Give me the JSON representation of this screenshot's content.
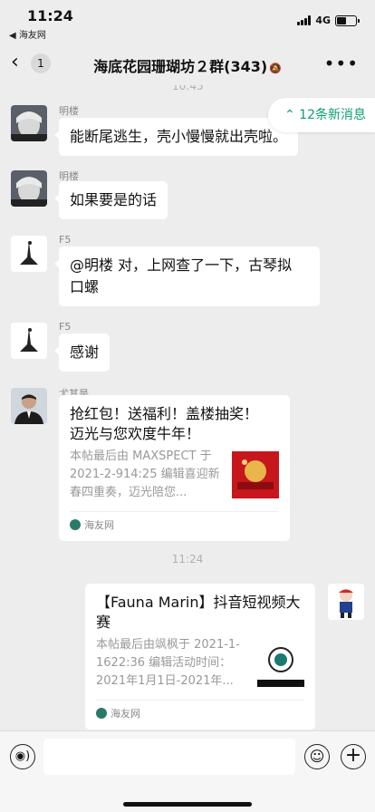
{
  "status": {
    "time": "11:24",
    "back_app": "◀ 海友网",
    "network": "4G",
    "battery_level": 0.5
  },
  "nav": {
    "back_icon": "‹",
    "unread": "1",
    "title": "海底花园珊瑚坊２群(343)",
    "mute_icon": "bell-off-icon",
    "more": "•••"
  },
  "chat": {
    "cut_time": "10:45",
    "new_messages": "⌃ 12条新消息",
    "messages": [
      {
        "sender": "明楼",
        "text": "能断尾逃生，壳小慢慢就出壳啦。"
      },
      {
        "sender": "明楼",
        "text": "如果要是的话"
      },
      {
        "sender": "F5",
        "line1": "@明楼 对，上网查了一下，古琴拟",
        "line2": "口螺"
      },
      {
        "sender": "F5",
        "text": "感谢"
      },
      {
        "sender": "尤其是",
        "card_title_1": "抢红包！送福利！盖楼抽奖！",
        "card_title_2": "迈光与您欢度牛年！",
        "card_desc": "本帖最后由 MAXSPECT 于 2021-2-914:25 编辑喜迎新春四重奏，迈光陪您...",
        "card_source": "海友网"
      }
    ],
    "time_divider": "11:24",
    "own_message": {
      "card_title": "【Fauna Marin】抖音短视频大赛",
      "card_desc": "本帖最后由飒枫于 2021-1-1622:36 编辑活动时间：2021年1月1日-2021年...",
      "card_source": "海友网"
    }
  },
  "input": {
    "voice_icon": "voice-icon",
    "emoji_icon": "emoji-icon",
    "plus_icon": "plus-icon"
  }
}
